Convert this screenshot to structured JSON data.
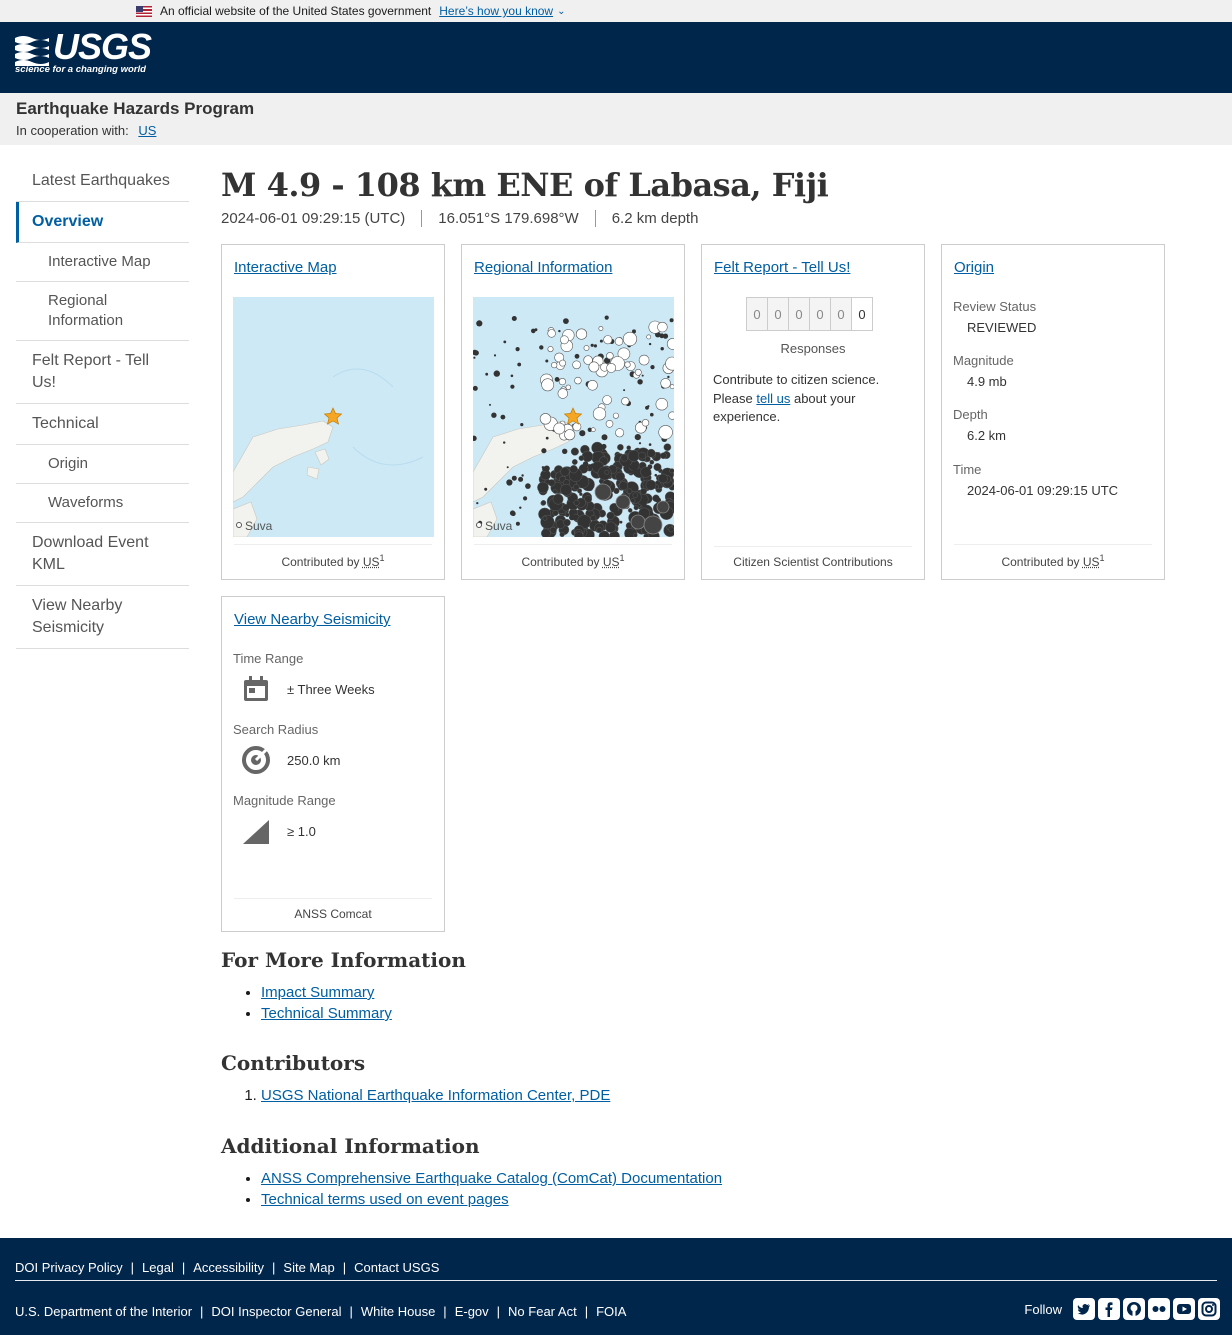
{
  "gov_banner": {
    "text": "An official website of the United States government",
    "link": "Here’s how you know"
  },
  "header": {
    "logo_word": "USGS",
    "logo_tagline": "science for a changing world"
  },
  "program": {
    "title": "Earthquake Hazards Program",
    "cooperation_label": "In cooperation with:",
    "cooperation_link": "US"
  },
  "sidebar": {
    "items": [
      {
        "label": "Latest Earthquakes"
      },
      {
        "label": "Overview"
      },
      {
        "label": "Interactive Map"
      },
      {
        "label": "Regional Information"
      },
      {
        "label": "Felt Report - Tell Us!"
      },
      {
        "label": "Technical"
      },
      {
        "label": "Origin"
      },
      {
        "label": "Waveforms"
      },
      {
        "label": "Download Event KML"
      },
      {
        "label": "View Nearby Seismicity"
      }
    ]
  },
  "event": {
    "title": "M 4.9 - 108 km ENE of Labasa, Fiji",
    "time": "2024-06-01 09:29:15 (UTC)",
    "coords": "16.051°S 179.698°W",
    "depth": "6.2 km depth"
  },
  "cards": {
    "interactive_map": {
      "title": "Interactive Map",
      "city": "Suva",
      "foot": "Contributed by",
      "abbr": "US",
      "sup": "1"
    },
    "regional": {
      "title": "Regional Information",
      "city": "Suva",
      "foot": "Contributed by",
      "abbr": "US",
      "sup": "1"
    },
    "felt": {
      "title": "Felt Report - Tell Us!",
      "digits": [
        "0",
        "0",
        "0",
        "0",
        "0",
        "0"
      ],
      "responses": "Responses",
      "text_before": "Contribute to citizen science. Please",
      "link": "tell us",
      "text_after": "about your experience.",
      "foot": "Citizen Scientist Contributions"
    },
    "origin": {
      "title": "Origin",
      "review_status_label": "Review Status",
      "review_status": "REVIEWED",
      "magnitude_label": "Magnitude",
      "magnitude": "4.9 mb",
      "depth_label": "Depth",
      "depth": "6.2 km",
      "time_label": "Time",
      "time": "2024-06-01 09:29:15 UTC",
      "foot": "Contributed by",
      "abbr": "US",
      "sup": "1"
    },
    "seismicity": {
      "title": "View Nearby Seismicity",
      "time_range_label": "Time Range",
      "time_range": "± Three Weeks",
      "radius_label": "Search Radius",
      "radius": "250.0 km",
      "mag_label": "Magnitude Range",
      "mag": "≥ 1.0",
      "foot": "ANSS Comcat"
    }
  },
  "more_info": {
    "title": "For More Information",
    "links": [
      "Impact Summary",
      "Technical Summary"
    ]
  },
  "contributors": {
    "title": "Contributors",
    "links": [
      "USGS National Earthquake Information Center, PDE"
    ]
  },
  "additional": {
    "title": "Additional Information",
    "links": [
      "ANSS Comprehensive Earthquake Catalog (ComCat) Documentation",
      "Technical terms used on event pages"
    ]
  },
  "footer": {
    "row1": [
      "DOI Privacy Policy",
      "Legal",
      "Accessibility",
      "Site Map",
      "Contact USGS"
    ],
    "row2": [
      "U.S. Department of the Interior",
      "DOI Inspector General",
      "White House",
      "E-gov",
      "No Fear Act",
      "FOIA"
    ],
    "follow": "Follow",
    "social": [
      "twitter-icon",
      "facebook-icon",
      "github-icon",
      "flickr-icon",
      "youtube-icon",
      "instagram-icon"
    ]
  },
  "colors": {
    "header_bg": "#00264c",
    "link": "#005ea2",
    "map_water": "#cce9f7",
    "star": "#f5a623"
  }
}
